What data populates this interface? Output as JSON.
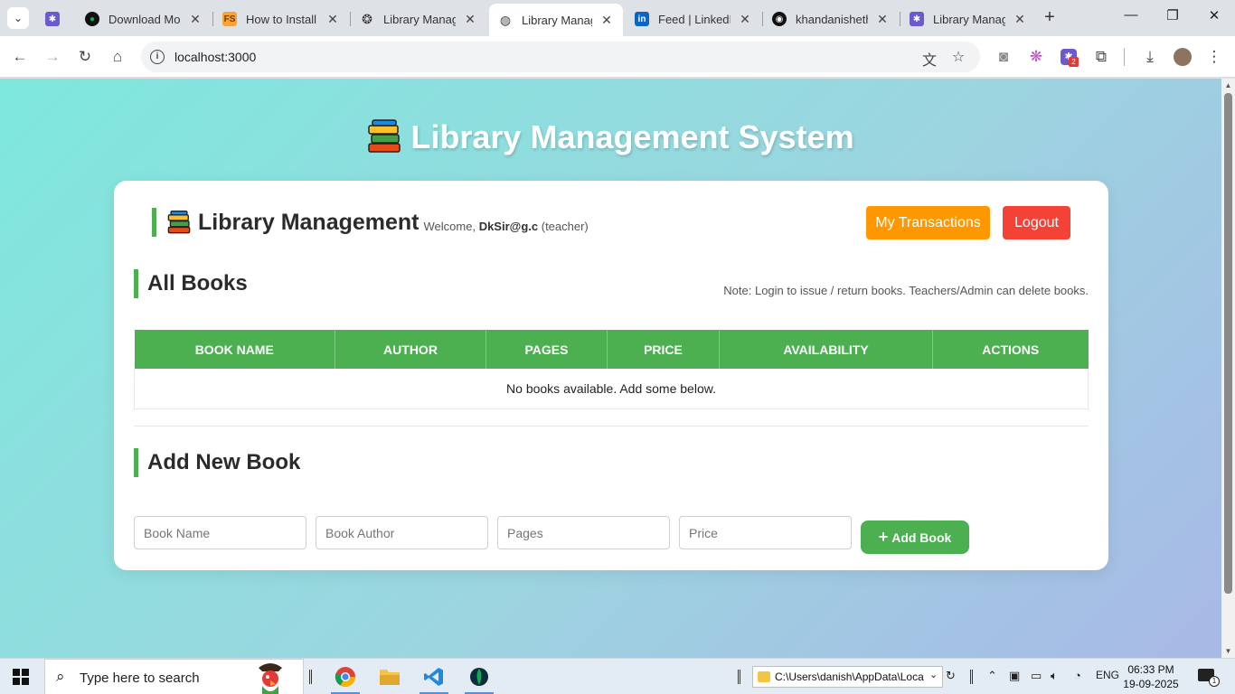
{
  "browser": {
    "tabs": [
      {
        "title": "",
        "favicon": "app-icon",
        "color": "#6a5acd"
      },
      {
        "title": "Download Mon",
        "favicon": "mongodb-leaf-icon",
        "color": "#13aa52"
      },
      {
        "title": "How to Install I",
        "favicon": "fs-icon",
        "color": "#f7a33a"
      },
      {
        "title": "Library Manage",
        "favicon": "chatgpt-icon",
        "color": "#333333"
      },
      {
        "title": "Library Manage",
        "favicon": "globe-icon",
        "color": "#444444",
        "active": true
      },
      {
        "title": "Feed | LinkedIn",
        "favicon": "linkedin-icon",
        "color": "#0a66c2"
      },
      {
        "title": "khandanisheth",
        "favicon": "github-icon",
        "color": "#111111"
      },
      {
        "title": "Library Manage",
        "favicon": "app-icon",
        "color": "#6a5acd"
      }
    ],
    "url": "localhost:3000",
    "extension_badge": "2"
  },
  "page": {
    "title": "Library Management System",
    "brand": "Library Management",
    "welcome_prefix": "Welcome, ",
    "user": "DkSir@g.c",
    "role": "(teacher)",
    "my_transactions": "My Transactions",
    "logout": "Logout",
    "all_books_heading": "All Books",
    "note": "Note: Login to issue / return books. Teachers/Admin can delete books.",
    "table": {
      "headers": [
        "BOOK NAME",
        "AUTHOR",
        "PAGES",
        "PRICE",
        "AVAILABILITY",
        "ACTIONS"
      ],
      "empty_message": "No books available. Add some below."
    },
    "add_heading": "Add New Book",
    "form": {
      "name_placeholder": "Book Name",
      "author_placeholder": "Book Author",
      "pages_placeholder": "Pages",
      "price_placeholder": "Price",
      "submit": "Add Book"
    },
    "colors": {
      "accent": "#4caf50",
      "orange": "#ff9800",
      "red": "#f44336"
    }
  },
  "taskbar": {
    "search_text": "Type here to search",
    "address": "C:\\Users\\danish\\AppData\\Loca",
    "language": "ENG",
    "time": "06:33 PM",
    "date": "19-09-2025"
  }
}
